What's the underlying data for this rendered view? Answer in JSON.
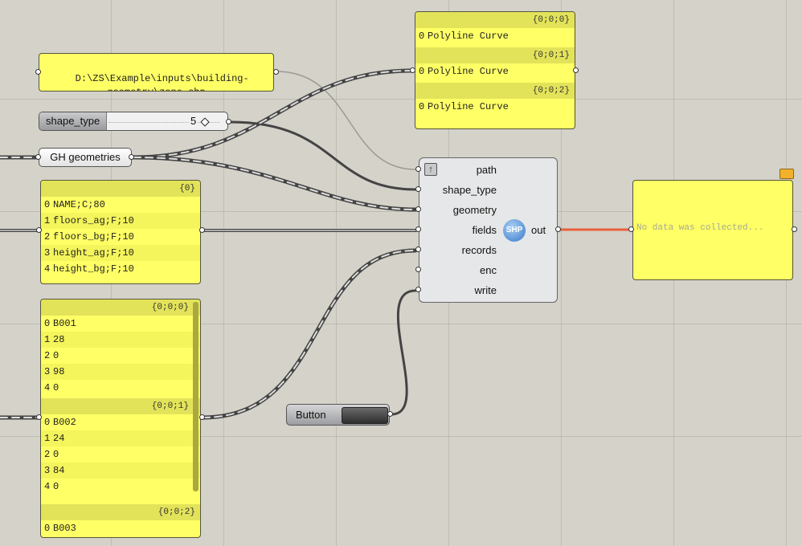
{
  "path_panel": {
    "text": "D:\\ZS\\Example\\inputs\\building-\ngeometry\\zone.shp"
  },
  "curves_panel": {
    "groups": [
      {
        "header": "{0;0;0}",
        "index": "0",
        "value": "Polyline Curve"
      },
      {
        "header": "{0;0;1}",
        "index": "0",
        "value": "Polyline Curve"
      },
      {
        "header": "{0;0;2}",
        "index": "0",
        "value": "Polyline Curve"
      }
    ]
  },
  "slider": {
    "label": "shape_type",
    "value": "5"
  },
  "gh_geometries": {
    "label": "GH geometries"
  },
  "fields_panel": {
    "header": "{0}",
    "rows": [
      {
        "index": "0",
        "value": "NAME;C;80"
      },
      {
        "index": "1",
        "value": "floors_ag;F;10"
      },
      {
        "index": "2",
        "value": "floors_bg;F;10"
      },
      {
        "index": "3",
        "value": "height_ag;F;10"
      },
      {
        "index": "4",
        "value": "height_bg;F;10"
      }
    ]
  },
  "records_panel": {
    "groups": [
      {
        "header": "{0;0;0}",
        "rows": [
          {
            "index": "0",
            "value": "B001"
          },
          {
            "index": "1",
            "value": "28"
          },
          {
            "index": "2",
            "value": "0"
          },
          {
            "index": "3",
            "value": "98"
          },
          {
            "index": "4",
            "value": "0"
          }
        ]
      },
      {
        "header": "{0;0;1}",
        "rows": [
          {
            "index": "0",
            "value": "B002"
          },
          {
            "index": "1",
            "value": "24"
          },
          {
            "index": "2",
            "value": "0"
          },
          {
            "index": "3",
            "value": "84"
          },
          {
            "index": "4",
            "value": "0"
          }
        ]
      },
      {
        "header": "{0;0;2}",
        "rows": [
          {
            "index": "0",
            "value": "B003"
          }
        ]
      }
    ]
  },
  "component": {
    "inputs": [
      "path",
      "shape_type",
      "geometry",
      "fields",
      "records",
      "enc",
      "write"
    ],
    "output": "out",
    "icon_text": "SHP",
    "icon": "globe-shp-icon"
  },
  "button": {
    "label": "Button"
  },
  "output_panel": {
    "text": "No data was collected..."
  },
  "colors": {
    "panel": "#ffff66",
    "error_wire": "#e8603c",
    "canvas": "#d4d2c9"
  }
}
